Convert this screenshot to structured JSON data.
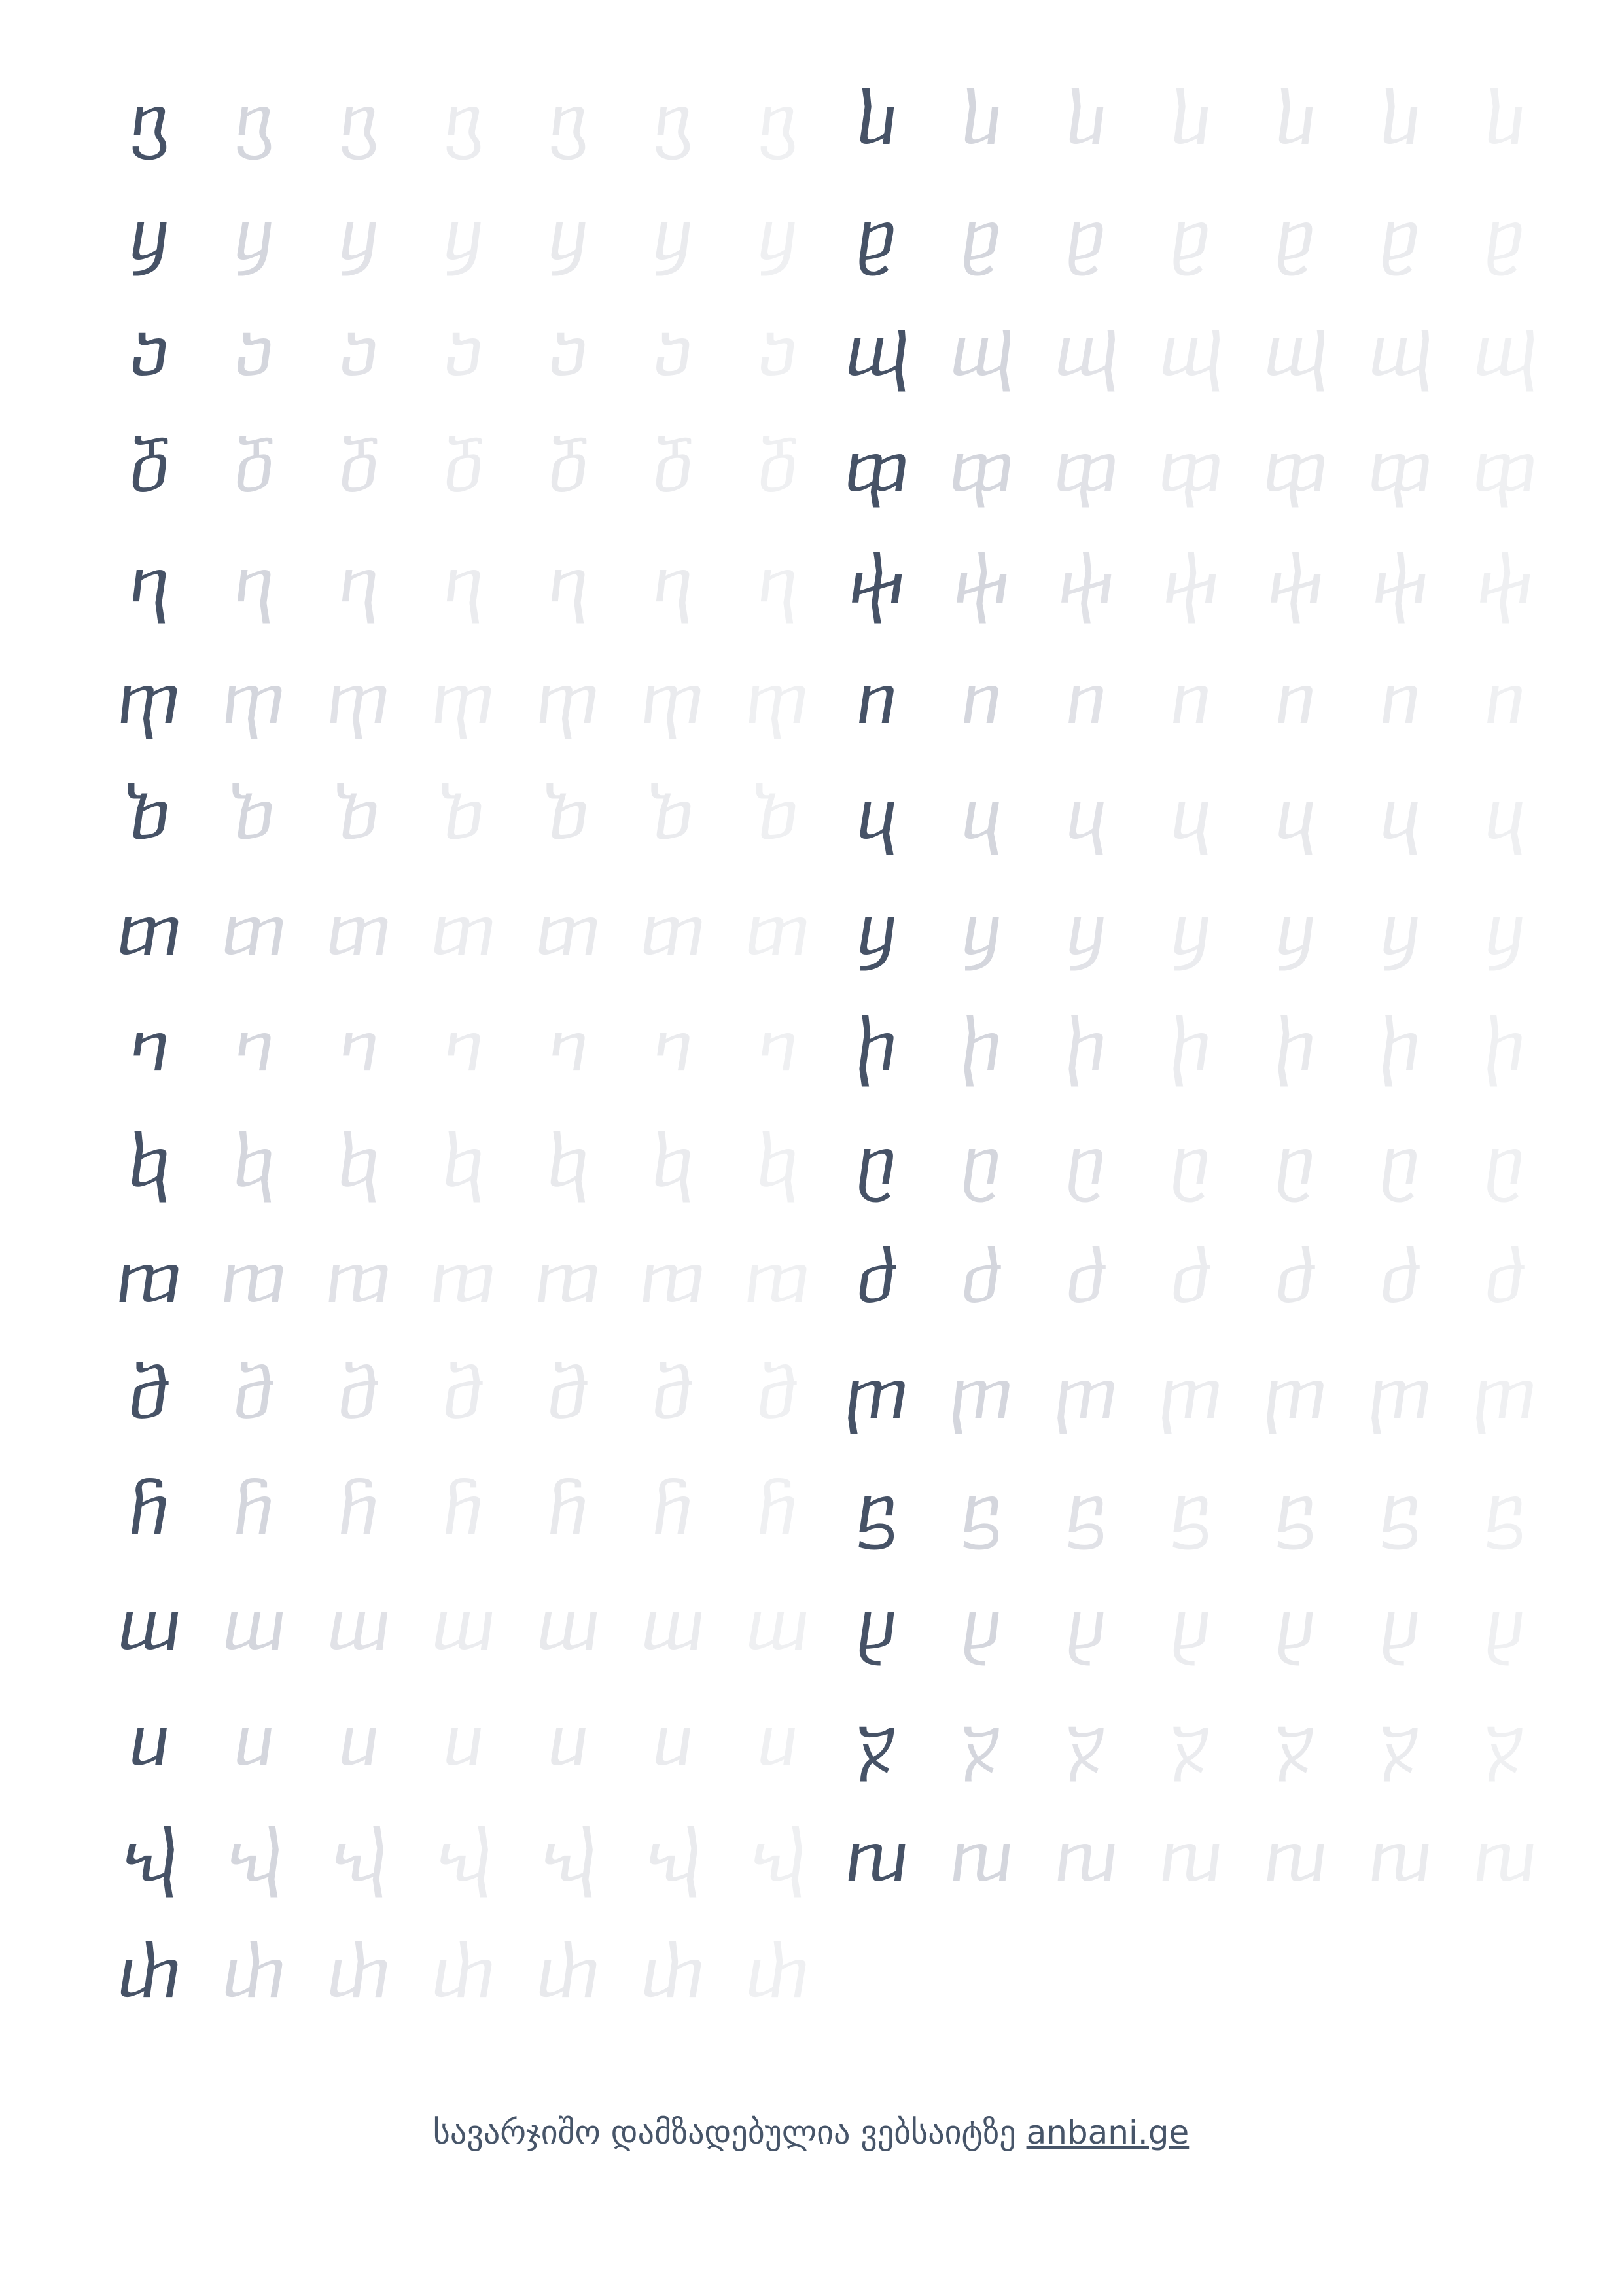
{
  "worksheet": {
    "left_column": [
      "ⴂ",
      "ⴘ",
      "ⴢ",
      "ⴃ",
      "ⴄ",
      "ⴅ",
      "ⴆ",
      "ⴇ",
      "ⴈ",
      "ⴉ",
      "ⴊ",
      "ⴋ",
      "ⴌ",
      "ⴍ",
      "ⴎ",
      "ⴏ",
      "ⴐ"
    ],
    "right_column": [
      "ⴑ",
      "ⴒ",
      "ⴓ",
      "ⴔ",
      "ⴕ",
      "ⴖ",
      "ⴗ",
      "ⴘ",
      "ⴙ",
      "ⴚ",
      "ⴛ",
      "ⴜ",
      "ⴝ",
      "ⴞ",
      "ⴟ",
      "ⴠ"
    ],
    "repetitions_per_row": 7
  },
  "footer": {
    "text": "სავარჯიშო დამზადებულია ვებსაიტზე",
    "link_text": "anbani.ge"
  }
}
